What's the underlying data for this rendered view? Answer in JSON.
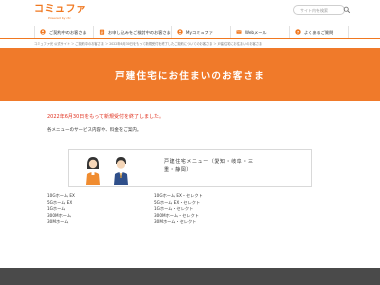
{
  "header": {
    "logo_text": "コミュファ",
    "logo_sub": "Powered by ctc",
    "search_placeholder": "サイト内を検索"
  },
  "nav": [
    {
      "label": "ご契約中のお客さま",
      "icon": "user-icon"
    },
    {
      "label": "お申し込みをご検討中のお客さま",
      "icon": "clipboard-icon"
    },
    {
      "label": "Myコミュファ",
      "icon": "person-icon"
    },
    {
      "label": "Webメール",
      "icon": "mail-icon"
    },
    {
      "label": "よくあるご質問",
      "icon": "question-icon"
    }
  ],
  "breadcrumb": "コミュファ光 公式サイト ＞ ご契約中のお客さま ＞ 2022年6月30日をもって新規受付を終了したご契約についてのお客さま ＞ 戸建住宅にお住まいのお客さま",
  "hero": {
    "title": "戸建住宅にお住まいのお客さま"
  },
  "notice": "2022年6月30日をもって新規受付を終了しました。",
  "intro": "各メニューのサービス内容や、料金をご案内。",
  "card": {
    "title": "戸建住宅メニュー（愛知・岐阜・三重・静岡）"
  },
  "plans_left": [
    "10Gホーム EX",
    "5Gホーム EX",
    "1Gホーム",
    "300Mホーム",
    "30Mホーム"
  ],
  "plans_right": [
    "10Gホーム EX・セレクト",
    "5Gホーム EX・セレクト",
    "1Gホーム・セレクト",
    "300Mホーム・セレクト",
    "30Mホーム・セレクト"
  ],
  "colors": {
    "brand": "#f07820",
    "hero": "#f07a2a",
    "notice": "#e0301e",
    "footer": "#4a4a4a"
  }
}
